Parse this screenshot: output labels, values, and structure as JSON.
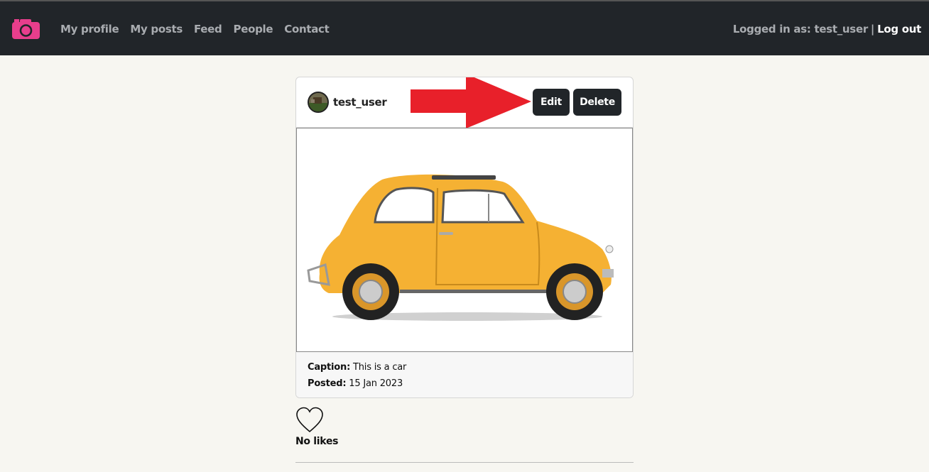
{
  "nav": {
    "brand_icon": "camera-icon",
    "links": [
      "My profile",
      "My posts",
      "Feed",
      "People",
      "Contact"
    ],
    "logged_in_label": "Logged in as: test_user",
    "separator": "|",
    "logout_label": "Log out"
  },
  "post": {
    "username": "test_user",
    "edit_label": "Edit",
    "delete_label": "Delete",
    "image_subject": "yellow-car",
    "caption_label": "Caption:",
    "caption_text": "This is a car",
    "posted_label": "Posted:",
    "posted_date": "15 Jan 2023",
    "likes_text": "No likes",
    "like_icon": "heart-icon"
  },
  "colors": {
    "navbar": "#212529",
    "brand": "#e83e8c",
    "arrow": "#e8202a",
    "car": "#f5b133"
  }
}
